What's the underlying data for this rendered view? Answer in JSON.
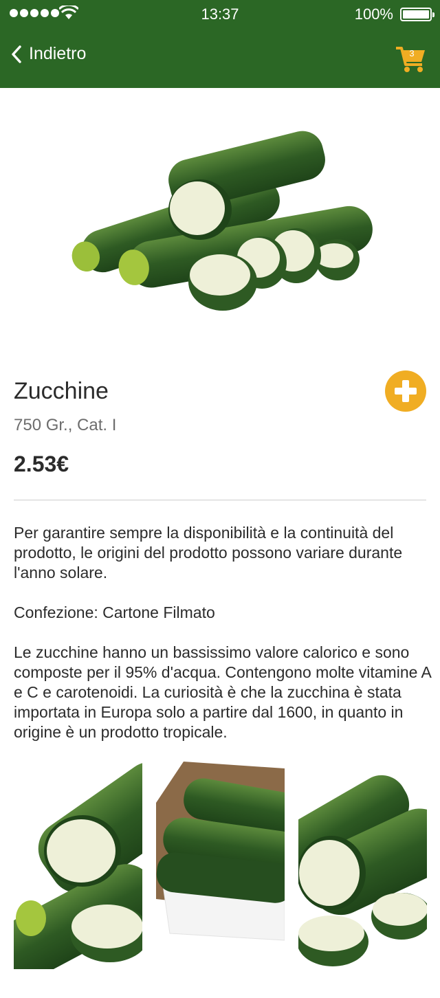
{
  "status_bar": {
    "time": "13:37",
    "battery": "100%"
  },
  "nav": {
    "back_label": "Indietro",
    "cart_count": "3"
  },
  "product": {
    "name": "Zucchine",
    "details": "750 Gr., Cat. I",
    "price": "2.53€",
    "description": [
      "Per garantire sempre la disponibilità e la continuità del prodotto, le origini del prodotto possono variare durante l'anno solare.",
      "Confezione: Cartone Filmato",
      "Le zucchine hanno un bassissimo valore calorico e sono composte per il 95% d'acqua. Contengono molte vitamine A e C e carotenoidi. La curiosità è che la zucchina è stata importata in Europa solo a partire dal 1600, in quanto in origine è un prodotto tropicale."
    ]
  },
  "colors": {
    "header": "#2b6725",
    "accent": "#f0ad23",
    "zucchini_dark": "#2e5a23",
    "zucchini_flesh": "#eef0d8"
  }
}
